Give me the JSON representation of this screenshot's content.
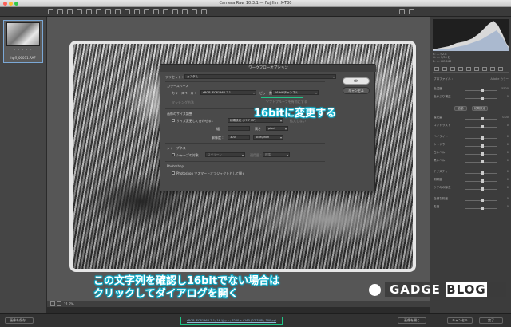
{
  "window": {
    "title": "Camera Raw 10.3.1 — Fujifilm X-T30"
  },
  "filmstrip": {
    "filename": "hpfl_00031.RAF",
    "stars": "· · · · ·"
  },
  "dialog": {
    "title": "ワークフローオプション",
    "preset_label": "プリセット :",
    "preset_value": "カスタム",
    "ok": "OK",
    "cancel": "キャンセル",
    "colorspace_section": "カラースペース",
    "colorspace_label": "カラースペース :",
    "colorspace_value": "sRGB IEC61966-2.1",
    "bitdepth_label": "ビット数 :",
    "bitdepth_value": "16 bit/チャンネル",
    "softproof_note": "ソフトプルーフを有効にする",
    "intent_label": "マッチング方法",
    "intent_value": "知覚的",
    "resize_section": "画像のサイズ調整",
    "resize_checkbox": "サイズ変更して合わせる :",
    "resize_value": "初期設定 (27.7 MP)",
    "enlarge_label": "拡大しない",
    "width_label": "幅",
    "height_label": "高さ",
    "pixel_unit": "pixel",
    "resolution_label": "解像度 :",
    "resolution_value": "300",
    "resolution_unit": "pixel/inch",
    "sharpen_section": "シャープネス",
    "sharpen_checkbox": "シャープの対象 :",
    "sharpen_target": "スクリーン",
    "amount_label": "適用量 :",
    "amount_value": "標準",
    "photoshop_section": "Photoshop",
    "smart_object_checkbox": "Photoshop でスマートオブジェクトとして開く"
  },
  "callouts": {
    "change_to_16bit": "16bitに変更する",
    "check_line1": "この文字列を確認し16bitでない場合は",
    "check_line2": "クリックしてダイアログを開く"
  },
  "zoom": {
    "value": "21.7%"
  },
  "panel": {
    "hist_info": [
      "R: ---  f/2.8",
      "G: ---  1/30 秒",
      "B: ---  ISO 160",
      "26 mm"
    ],
    "rows": [
      {
        "label": "プロファイル :",
        "value": "Adobe カラー"
      },
      {
        "label": "色温度",
        "value": "5500"
      },
      {
        "label": "色かぶり補正",
        "value": "0"
      },
      {
        "label": "自動",
        "value": "初期設定"
      },
      {
        "label": "露光量",
        "value": "0.00"
      },
      {
        "label": "コントラスト",
        "value": "0"
      },
      {
        "label": "ハイライト",
        "value": "0"
      },
      {
        "label": "シャドウ",
        "value": "0"
      },
      {
        "label": "白レベル",
        "value": "0"
      },
      {
        "label": "黒レベル",
        "value": "0"
      },
      {
        "label": "テクスチャ",
        "value": "0"
      },
      {
        "label": "明瞭度",
        "value": "0"
      },
      {
        "label": "かすみの除去",
        "value": "0"
      },
      {
        "label": "自然な彩度",
        "value": "0"
      },
      {
        "label": "彩度",
        "value": "0"
      }
    ]
  },
  "bottom": {
    "save_button": "画像を保存...",
    "workflow_link": "sRGB IEC61966-2.1; 16 ビット; 6240 x 4160 (27.7MP); 300 ppi",
    "open_button": "画像を開く",
    "cancel_button": "キャンセル",
    "done_button": "完了"
  },
  "logo": {
    "text_main": "GADGE",
    "text_sub": "BLOG"
  },
  "colors": {
    "accent_green": "#1fc587",
    "callout_glow": "#19c3e0"
  }
}
